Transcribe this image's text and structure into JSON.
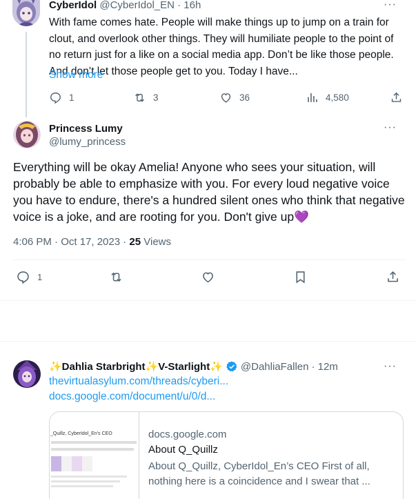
{
  "tweet1": {
    "name": "CyberIdol",
    "handle": "@CyberIdol_EN",
    "time": "· 16h",
    "text": "With fame comes hate. People will make things up to jump on a train for clout, and overlook other things. They will humiliate people to the point of no return just for a like on a social media app. Don’t be like those people. And don’t let those people get to you. Today I have...",
    "show_more": "Show more",
    "more_icon": "···",
    "replies": "1",
    "retweets": "3",
    "likes": "36",
    "views": "4,580"
  },
  "tweet2": {
    "name": "Princess Lumy",
    "handle": "@lumy_princess",
    "more_icon": "···",
    "text": "Everything will be okay Amelia! Anyone who sees your situation, will probably be able to emphasize with you. For every loud negative voice you have to endure, there's a hundred silent ones who think that negative voice is a joke, and are rooting for you. Don't give up💜",
    "timestamp": "4:06 PM · Oct 17, 2023 · ",
    "views_count": "25",
    "views_label": " Views",
    "replies": "1"
  },
  "tweet3": {
    "name": "✨Dahlia Starbright✨V-Starlight✨",
    "handle": "@DahliaFallen",
    "time": "· 12m",
    "more_icon": "···",
    "link1": "thevirtualasylum.com/threads/cyberi...",
    "link2": "docs.google.com/document/u/0/d...",
    "card": {
      "domain": "docs.google.com",
      "title": "About Q_Quillz",
      "description": "About Q_Quillz, CyberIdol_En’s CEO First of all, nothing here is a coincidence and I swear that ...",
      "thumb_title": "_Quillz, CyberIdol_En's CEO"
    }
  },
  "colors": {
    "accent": "#1d9bf0",
    "muted": "#536471",
    "text": "#0f1419",
    "border": "#cfd9de"
  }
}
